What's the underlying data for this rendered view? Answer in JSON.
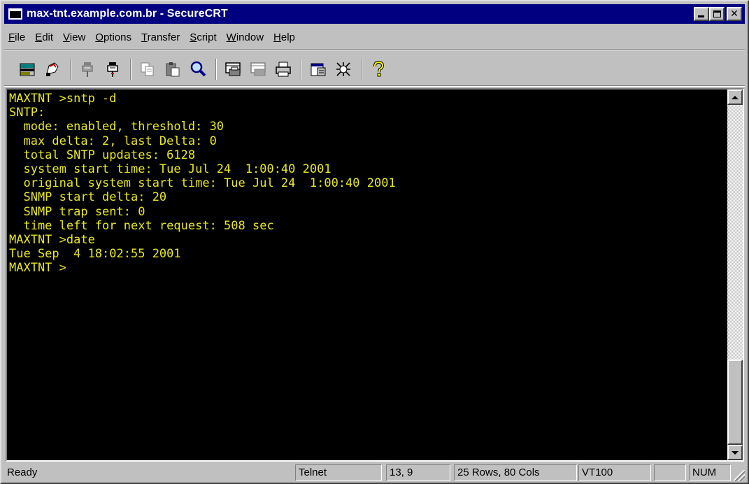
{
  "window": {
    "title": "max-tnt.example.com.br - SecureCRT"
  },
  "menu": [
    {
      "label": "File",
      "accel": "F",
      "rest": "ile"
    },
    {
      "label": "Edit",
      "accel": "E",
      "rest": "dit"
    },
    {
      "label": "View",
      "accel": "V",
      "rest": "iew"
    },
    {
      "label": "Options",
      "accel": "O",
      "rest": "ptions"
    },
    {
      "label": "Transfer",
      "accel": "T",
      "rest": "ransfer"
    },
    {
      "label": "Script",
      "accel": "S",
      "rest": "cript"
    },
    {
      "label": "Window",
      "accel": "W",
      "rest": "indow"
    },
    {
      "label": "Help",
      "accel": "H",
      "rest": "elp"
    }
  ],
  "toolbar_icons": [
    "connect-icon",
    "quick-connect-icon",
    "connect-in-tab-icon",
    "disconnect-icon",
    "copy-icon",
    "paste-icon",
    "find-icon",
    "print-screen-icon",
    "print-selection-icon",
    "print-icon",
    "session-options-icon",
    "global-options-icon",
    "help-icon"
  ],
  "terminal": {
    "lines": [
      "MAXTNT >sntp -d",
      "SNTP:",
      "  mode: enabled, threshold: 30",
      "  max delta: 2, last Delta: 0",
      "  total SNTP updates: 6128",
      "  system start time: Tue Jul 24  1:00:40 2001",
      "  original system start time: Tue Jul 24  1:00:40 2001",
      "  SNMP start delta: 20",
      "  SNMP trap sent: 0",
      "  time left for next request: 508 sec",
      "MAXTNT >date",
      "Tue Sep  4 18:02:55 2001",
      "MAXTNT >"
    ],
    "text_color": "#e8e820",
    "background": "#000000"
  },
  "status": {
    "ready": "Ready",
    "protocol": "Telnet",
    "cursor": "13,  9",
    "size": "25 Rows, 80 Cols",
    "emulation": "VT100",
    "caps": "",
    "num": "NUM"
  }
}
